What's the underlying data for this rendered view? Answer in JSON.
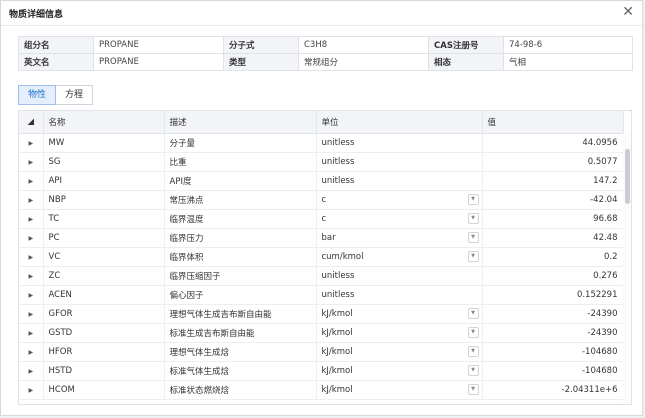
{
  "dialog": {
    "title": "物质详细信息"
  },
  "info": [
    [
      {
        "label": "组分名",
        "value": "PROPANE"
      },
      {
        "label": "分子式",
        "value": "C3H8"
      },
      {
        "label": "CAS注册号",
        "value": "74-98-6"
      }
    ],
    [
      {
        "label": "英文名",
        "value": "PROPANE"
      },
      {
        "label": "类型",
        "value": "常规组分"
      },
      {
        "label": "相态",
        "value": "气相"
      }
    ]
  ],
  "tabs": [
    "物性",
    "方程"
  ],
  "grid": {
    "headers": {
      "name": "名称",
      "desc": "描述",
      "unit": "单位",
      "value": "值"
    },
    "rows": [
      {
        "name": "MW",
        "desc": "分子量",
        "unit": "unitless",
        "value": "44.0956",
        "dd": false
      },
      {
        "name": "SG",
        "desc": "比重",
        "unit": "unitless",
        "value": "0.5077",
        "dd": false
      },
      {
        "name": "API",
        "desc": "API度",
        "unit": "unitless",
        "value": "147.2",
        "dd": false
      },
      {
        "name": "NBP",
        "desc": "常压沸点",
        "unit": "c",
        "value": "-42.04",
        "dd": true
      },
      {
        "name": "TC",
        "desc": "临界温度",
        "unit": "c",
        "value": "96.68",
        "dd": true
      },
      {
        "name": "PC",
        "desc": "临界压力",
        "unit": "bar",
        "value": "42.48",
        "dd": true
      },
      {
        "name": "VC",
        "desc": "临界体积",
        "unit": "cum/kmol",
        "value": "0.2",
        "dd": true
      },
      {
        "name": "ZC",
        "desc": "临界压缩因子",
        "unit": "unitless",
        "value": "0.276",
        "dd": false
      },
      {
        "name": "ACEN",
        "desc": "偏心因子",
        "unit": "unitless",
        "value": "0.152291",
        "dd": false
      },
      {
        "name": "GFOR",
        "desc": "理想气体生成吉布斯自由能",
        "unit": "kJ/kmol",
        "value": "-24390",
        "dd": true
      },
      {
        "name": "GSTD",
        "desc": "标准生成吉布斯自由能",
        "unit": "kJ/kmol",
        "value": "-24390",
        "dd": true
      },
      {
        "name": "HFOR",
        "desc": "理想气体生成焓",
        "unit": "kJ/kmol",
        "value": "-104680",
        "dd": true
      },
      {
        "name": "HSTD",
        "desc": "标准气体生成焓",
        "unit": "kJ/kmol",
        "value": "-104680",
        "dd": true
      },
      {
        "name": "HCOM",
        "desc": "标准状态燃烧焓",
        "unit": "kJ/kmol",
        "value": "-2.04311e+6",
        "dd": true
      }
    ]
  }
}
